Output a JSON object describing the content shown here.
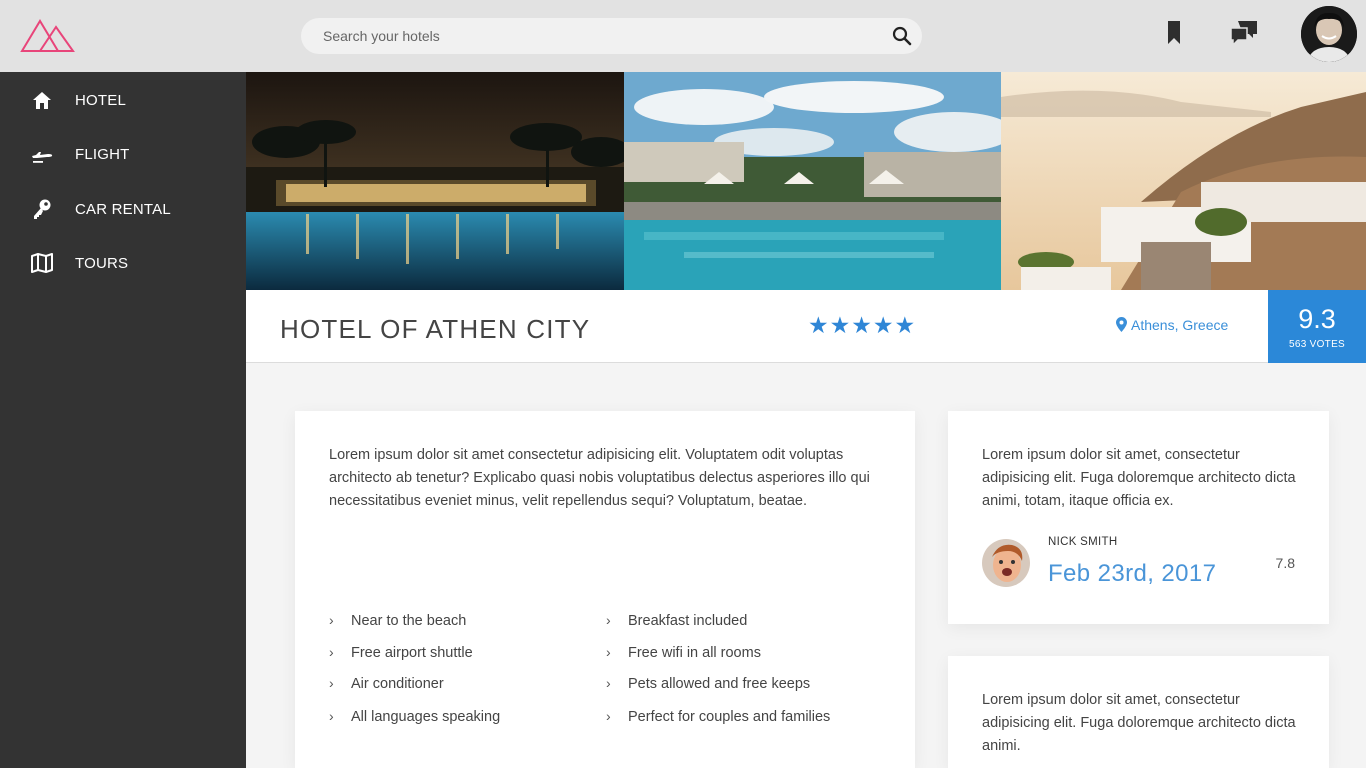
{
  "search": {
    "placeholder": "Search your hotels"
  },
  "colors": {
    "accent": "#2b88d8",
    "sidebar": "#333333",
    "logo": "#e8457a",
    "topbar": "#e2e2e2"
  },
  "icons": {
    "logo": "mountain-logo",
    "search": "search-icon",
    "bookmark": "bookmark-icon",
    "chat": "chat-icon"
  },
  "sidebar": {
    "items": [
      {
        "label": "HOTEL",
        "icon": "home-icon"
      },
      {
        "label": "FLIGHT",
        "icon": "plane-icon"
      },
      {
        "label": "CAR RENTAL",
        "icon": "key-icon"
      },
      {
        "label": "TOURS",
        "icon": "map-icon"
      }
    ]
  },
  "hotel": {
    "title": "HOTEL OF ATHEN CITY",
    "stars": "★★★★★",
    "rating_stars": 5,
    "location": "Athens, Greece",
    "score": "9.3",
    "votes": "563 VOTES"
  },
  "main": {
    "description": "Lorem ipsum dolor sit amet consectetur adipisicing elit. Voluptatem odit voluptas architecto ab tenetur? Explicabo quasi nobis voluptatibus delectus asperiores illo qui necessitatibus eveniet minus, velit repellendus sequi? Voluptatum, beatae.",
    "amenities_left": [
      "Near to the beach",
      "Free airport shuttle",
      "Air conditioner",
      "All languages speaking"
    ],
    "amenities_right": [
      "Breakfast included",
      "Free wifi in all rooms",
      "Pets allowed and free keeps",
      "Perfect for couples and families"
    ]
  },
  "reviews": [
    {
      "text": "Lorem ipsum dolor sit amet, consectetur adipisicing elit. Fuga doloremque architecto dicta animi, totam, itaque officia ex.",
      "author": "NICK SMITH",
      "date": "Feb 23rd, 2017",
      "score": "7.8"
    },
    {
      "text": "Lorem ipsum dolor sit amet, consectetur adipisicing elit. Fuga doloremque architecto dicta animi."
    }
  ]
}
